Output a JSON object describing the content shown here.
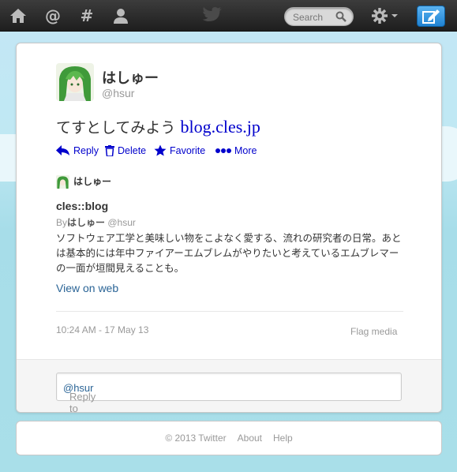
{
  "nav": {
    "home_icon": "home-icon",
    "connect_icon": "at-icon",
    "discover_icon": "hash-icon",
    "me_icon": "person-icon",
    "search_placeholder": "Search",
    "settings_icon": "gear-icon",
    "compose_icon": "compose-icon"
  },
  "tweet": {
    "display_name": "はしゅー",
    "screen_name": "@hsur",
    "text": "てすとしてみよう",
    "link_text": "blog.cles.jp",
    "actions": {
      "reply": "Reply",
      "delete": "Delete",
      "favorite": "Favorite",
      "more": "More"
    },
    "media": {
      "author_name": "はしゅー",
      "title": "cles::blog",
      "by_label": "By",
      "by_name": "はしゅー",
      "by_handle": "@hsur",
      "description": "ソフトウェア工学と美味しい物をこよなく愛する、流れの研究者の日常。あとは基本的には年中ファイアーエムブレムがやりたいと考えているエムブレマーの一面が垣間見えることも。",
      "view_on_web": "View on web"
    },
    "timestamp": "10:24 AM - 17 May 13",
    "flag_media": "Flag media",
    "reply_prefix": "Reply to",
    "reply_mention": "@hsur"
  },
  "footer": {
    "copyright": "© 2013 Twitter",
    "about": "About",
    "help": "Help"
  },
  "colors": {
    "link": "#0000cc",
    "compose_button": "#2a8ad9",
    "topbar": "#2b2b2b",
    "sky": "#b7e3ee"
  }
}
